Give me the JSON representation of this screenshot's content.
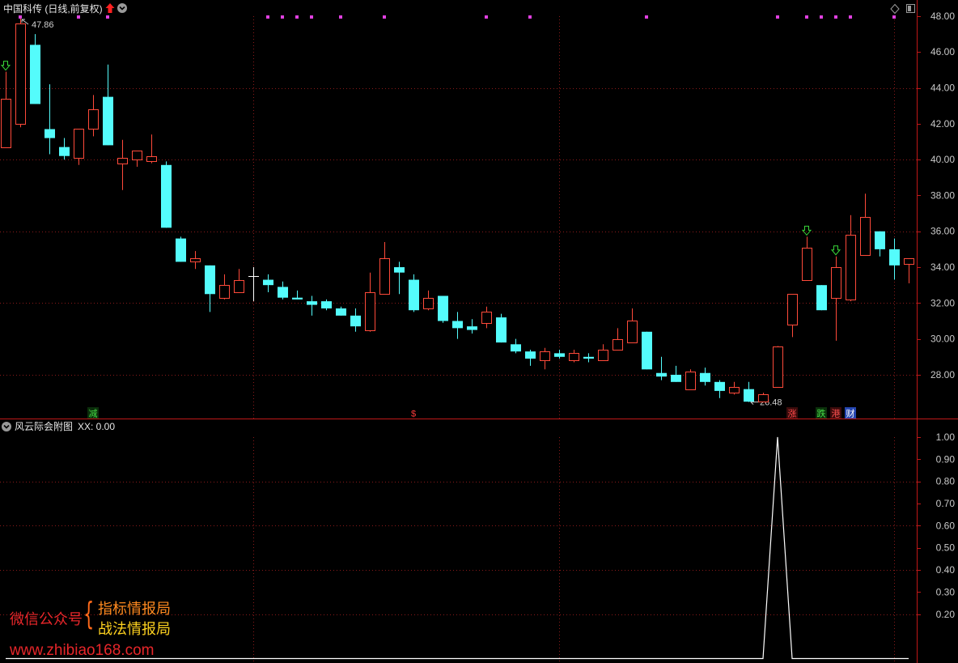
{
  "colors": {
    "up": "#ff4a3a",
    "down": "#54fcfc",
    "flat": "#ffffff",
    "grid": "#8a1a1a",
    "border": "#c01818",
    "axis_text": "#c8c8c8",
    "line": "#ffffff",
    "marker": "#e040e0",
    "arrow": "#39d639",
    "icon": "#9a9a9a",
    "title_flag": "#ff2020"
  },
  "icons": {
    "title_menu": "chevron-down-circle-icon",
    "title_flag": "arrow-up-icon",
    "top_right_1": "diamond-icon",
    "top_right_2": "layout-icon",
    "sub_menu": "chevron-down-circle-icon"
  },
  "watermark": {
    "line1": "微信公众号",
    "brace": "{",
    "item1": "指标情报局",
    "item2": "战法情报局",
    "url": "www.zhibiao168.com"
  },
  "chart_data": [
    {
      "type": "bar",
      "style": "candlestick",
      "title": "中国科传 (日线,前复权)",
      "fields": [
        "open",
        "close",
        "high",
        "low"
      ],
      "candles": [
        [
          40.7,
          43.4,
          44.9,
          40.7
        ],
        [
          42.0,
          47.6,
          47.86,
          41.8
        ],
        [
          46.4,
          43.1,
          47.0,
          43.1
        ],
        [
          41.7,
          41.2,
          44.2,
          40.3
        ],
        [
          40.7,
          40.2,
          41.2,
          40.0
        ],
        [
          40.1,
          41.7,
          41.7,
          39.7
        ],
        [
          41.7,
          42.8,
          43.6,
          41.3
        ],
        [
          43.5,
          40.8,
          45.3,
          40.8
        ],
        [
          39.8,
          40.1,
          41.1,
          38.3
        ],
        [
          40.0,
          40.5,
          40.5,
          39.6
        ],
        [
          39.9,
          40.2,
          41.4,
          39.8
        ],
        [
          39.7,
          36.2,
          39.9,
          36.2
        ],
        [
          35.6,
          34.3,
          35.7,
          34.3
        ],
        [
          34.3,
          34.5,
          34.9,
          33.9
        ],
        [
          34.1,
          32.5,
          34.1,
          31.5
        ],
        [
          32.3,
          33.0,
          33.6,
          32.2
        ],
        [
          32.6,
          33.3,
          33.9,
          32.6
        ],
        [
          33.5,
          33.5,
          34.0,
          32.1
        ],
        [
          33.3,
          33.0,
          33.6,
          32.6
        ],
        [
          32.9,
          32.3,
          33.2,
          32.2
        ],
        [
          32.3,
          32.2,
          32.7,
          32.2
        ],
        [
          32.1,
          31.9,
          32.4,
          31.3
        ],
        [
          32.1,
          31.7,
          32.2,
          31.6
        ],
        [
          31.7,
          31.3,
          31.8,
          31.3
        ],
        [
          31.3,
          30.7,
          31.7,
          30.4
        ],
        [
          30.5,
          32.6,
          33.7,
          30.4
        ],
        [
          32.5,
          34.5,
          35.4,
          32.5
        ],
        [
          34.0,
          33.7,
          34.3,
          32.5
        ],
        [
          33.3,
          31.6,
          33.6,
          31.5
        ],
        [
          31.7,
          32.3,
          32.7,
          31.6
        ],
        [
          32.4,
          31.0,
          32.4,
          30.9
        ],
        [
          31.0,
          30.6,
          31.5,
          30.0
        ],
        [
          30.7,
          30.5,
          31.1,
          30.3
        ],
        [
          30.9,
          31.5,
          31.8,
          30.6
        ],
        [
          31.2,
          29.8,
          31.4,
          29.8
        ],
        [
          29.7,
          29.3,
          30.0,
          29.2
        ],
        [
          29.3,
          28.9,
          29.4,
          28.5
        ],
        [
          28.8,
          29.3,
          29.5,
          28.3
        ],
        [
          29.2,
          29.0,
          29.4,
          28.9
        ],
        [
          28.8,
          29.2,
          29.4,
          28.7
        ],
        [
          29.0,
          28.9,
          29.2,
          28.7
        ],
        [
          28.8,
          29.4,
          29.7,
          28.8
        ],
        [
          29.4,
          30.0,
          30.6,
          29.4
        ],
        [
          29.8,
          31.0,
          31.7,
          29.8
        ],
        [
          30.4,
          28.3,
          30.4,
          28.3
        ],
        [
          28.1,
          27.9,
          29.0,
          27.7
        ],
        [
          28.0,
          27.6,
          28.5,
          27.6
        ],
        [
          27.2,
          28.2,
          28.3,
          27.2
        ],
        [
          28.1,
          27.6,
          28.4,
          27.4
        ],
        [
          27.6,
          27.1,
          27.7,
          26.7
        ],
        [
          27.0,
          27.3,
          27.6,
          26.9
        ],
        [
          27.2,
          26.5,
          27.6,
          26.48
        ],
        [
          26.5,
          26.9,
          27.0,
          26.5
        ],
        [
          27.3,
          29.6,
          29.6,
          27.3
        ],
        [
          30.8,
          32.5,
          32.5,
          30.1
        ],
        [
          33.3,
          35.1,
          35.7,
          33.3
        ],
        [
          33.0,
          31.6,
          33.0,
          31.6
        ],
        [
          32.3,
          34.0,
          34.6,
          29.9
        ],
        [
          32.2,
          35.8,
          36.9,
          32.1
        ],
        [
          34.7,
          36.8,
          38.1,
          34.7
        ],
        [
          36.0,
          35.0,
          36.0,
          34.6
        ],
        [
          35.0,
          34.1,
          35.6,
          33.3
        ],
        [
          34.2,
          34.5,
          34.5,
          33.1
        ]
      ],
      "yticks": [
        "48.00",
        "46.00",
        "44.00",
        "42.00",
        "40.00",
        "38.00",
        "36.00",
        "34.00",
        "32.00",
        "30.00",
        "28.00"
      ],
      "ylim": [
        25.56,
        48.9
      ],
      "grid": true,
      "high_label": {
        "candle": 1,
        "text": "47.86"
      },
      "low_label": {
        "candle": 51,
        "text": "26.48"
      },
      "arrow_markers": [
        0,
        55,
        57
      ],
      "top_markers": [
        1,
        5,
        7,
        18,
        19,
        20,
        21,
        23,
        26,
        33,
        36,
        44,
        53,
        55,
        56,
        57,
        58,
        61
      ],
      "bottom_signals": [
        {
          "candle": 6,
          "text": "减",
          "color": "#44dd44",
          "bg": "#0b2e0b"
        },
        {
          "candle": 28,
          "text": "$",
          "color": "#ff3b3b",
          "bg": "#000000"
        },
        {
          "candle": 54,
          "text": "涨",
          "color": "#ff4a4a",
          "bg": "#3a0b0b"
        },
        {
          "candle": 56,
          "text": "跌",
          "color": "#49e049",
          "bg": "#0b300b"
        },
        {
          "candle": 57,
          "text": "港",
          "color": "#ff5050",
          "bg": "#3a0b0b"
        },
        {
          "candle": 58,
          "text": "财",
          "color": "#ffffff",
          "bg": "#2445b0"
        }
      ]
    },
    {
      "type": "line",
      "title": "风云际会附图",
      "readout": "XX: 0.00",
      "series": [
        {
          "values": [
            0,
            0,
            0,
            0,
            0,
            0,
            0,
            0,
            0,
            0,
            0,
            0,
            0,
            0,
            0,
            0,
            0,
            0,
            0,
            0,
            0,
            0,
            0,
            0,
            0,
            0,
            0,
            0,
            0,
            0,
            0,
            0,
            0,
            0,
            0,
            0,
            0,
            0,
            0,
            0,
            0,
            0,
            0,
            0,
            0,
            0,
            0,
            0,
            0,
            0,
            0,
            0,
            0,
            1,
            0,
            0,
            0,
            0,
            0,
            0,
            0,
            0,
            0
          ]
        }
      ],
      "yticks": [
        "1.00",
        "0.90",
        "0.80",
        "0.70",
        "0.60",
        "0.50",
        "0.40",
        "0.30",
        "0.20"
      ],
      "ylim": [
        -0.02,
        1.08
      ],
      "grid": true
    }
  ]
}
